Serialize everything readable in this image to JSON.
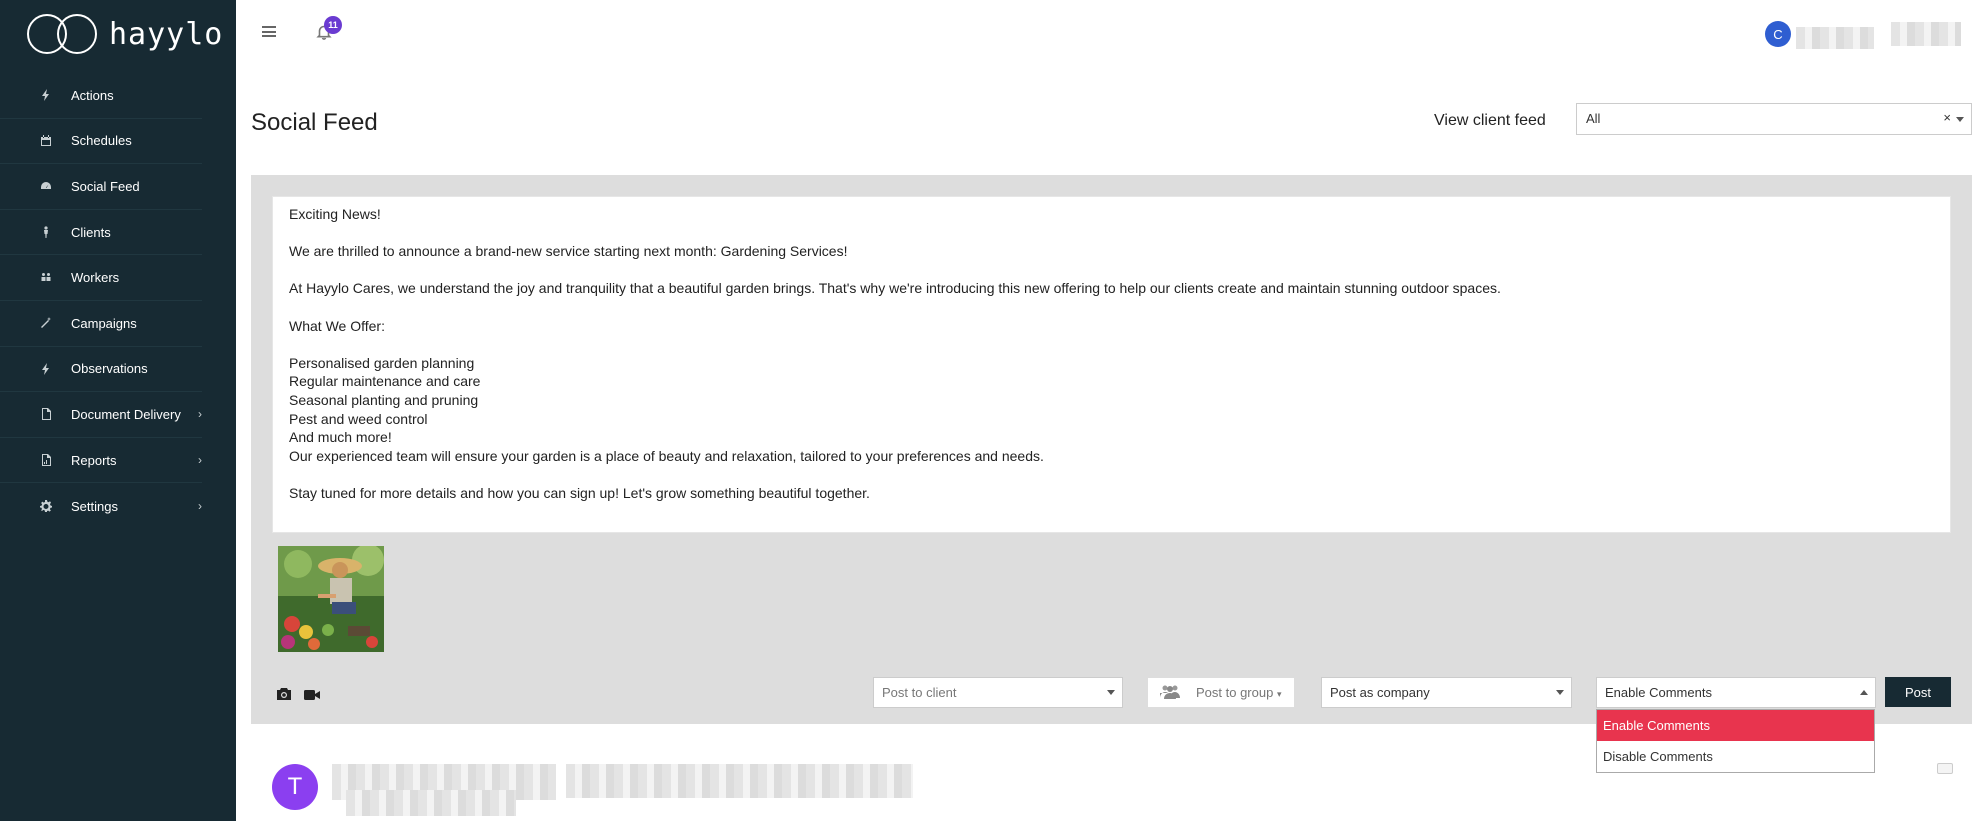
{
  "app": {
    "logo_text": "hayylo"
  },
  "topbar": {
    "notification_count": "11",
    "user_initial": "C"
  },
  "sidebar": {
    "items": [
      {
        "label": "Actions",
        "icon": "bolt-icon",
        "has_submenu": false
      },
      {
        "label": "Schedules",
        "icon": "calendar-icon",
        "has_submenu": false
      },
      {
        "label": "Social Feed",
        "icon": "dashboard-icon",
        "has_submenu": false,
        "active": true
      },
      {
        "label": "Clients",
        "icon": "person-icon",
        "has_submenu": false
      },
      {
        "label": "Workers",
        "icon": "users-icon",
        "has_submenu": false
      },
      {
        "label": "Campaigns",
        "icon": "wand-icon",
        "has_submenu": false
      },
      {
        "label": "Observations",
        "icon": "bolt-icon",
        "has_submenu": false
      },
      {
        "label": "Document Delivery",
        "icon": "document-icon",
        "has_submenu": true
      },
      {
        "label": "Reports",
        "icon": "report-icon",
        "has_submenu": true
      },
      {
        "label": "Settings",
        "icon": "gear-icon",
        "has_submenu": true
      }
    ]
  },
  "header": {
    "title": "Social Feed",
    "view_client_label": "View client feed",
    "client_filter_value": "All",
    "clear_symbol": "×"
  },
  "composer": {
    "lines": [
      "Exciting News!",
      "",
      "We are thrilled to announce a brand-new service starting next month: Gardening Services!",
      "",
      "At Hayylo Cares, we understand the joy and tranquility that a beautiful garden brings. That's why we're introducing this new offering to help our clients create and maintain stunning outdoor spaces.",
      "",
      "What We Offer:",
      "",
      "Personalised garden planning",
      "Regular maintenance and care",
      "Seasonal planting and pruning",
      "Pest and weed control",
      "And much more!",
      "Our experienced team will ensure your garden is a place of beauty and relaxation, tailored to your preferences and needs.",
      "",
      "Stay tuned for more details and how you can sign up! Let's grow something beautiful together."
    ],
    "post_to_client_placeholder": "Post to client",
    "post_to_group_label": "Post to group",
    "post_as_value": "Post as company",
    "comments_value": "Enable Comments",
    "post_button": "Post",
    "comments_options": [
      "Enable Comments",
      "Disable Comments"
    ],
    "highlight_color": "#e8344e"
  },
  "feed": {
    "first_post_avatar_initial": "T"
  }
}
